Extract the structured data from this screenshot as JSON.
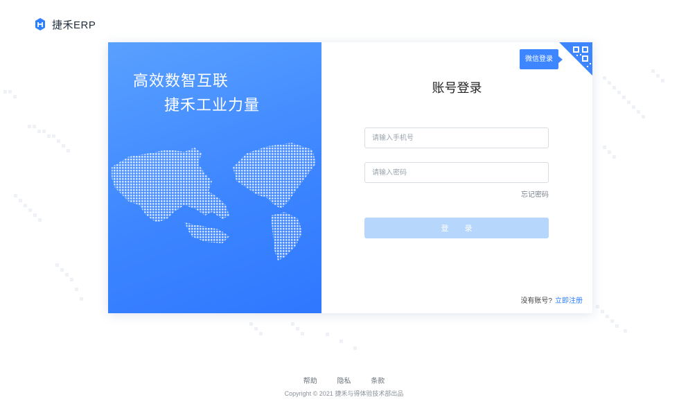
{
  "brand": {
    "logo_icon": "jiehe-logo-icon",
    "name": "捷禾ERP"
  },
  "hero": {
    "slogan_line1": "高效数智互联",
    "slogan_line2": "捷禾工业力量"
  },
  "login": {
    "title": "账号登录",
    "phone_placeholder": "请输入手机号",
    "phone_value": "",
    "password_placeholder": "请输入密码",
    "password_value": "",
    "forgot_label": "忘记密码",
    "submit_label": "登 录",
    "no_account_text": "没有账号?",
    "register_label": "立即注册",
    "wechat_login_label": "微信登录",
    "qr_icon": "qrcode-icon"
  },
  "footer": {
    "links": [
      "帮助",
      "隐私",
      "条款"
    ],
    "copyright": "Copyright © 2021 捷禾与得体验技术部出品"
  },
  "colors": {
    "primary": "#3d86ff",
    "button_disabled": "#b6d6fb",
    "link": "#2f80ff"
  }
}
